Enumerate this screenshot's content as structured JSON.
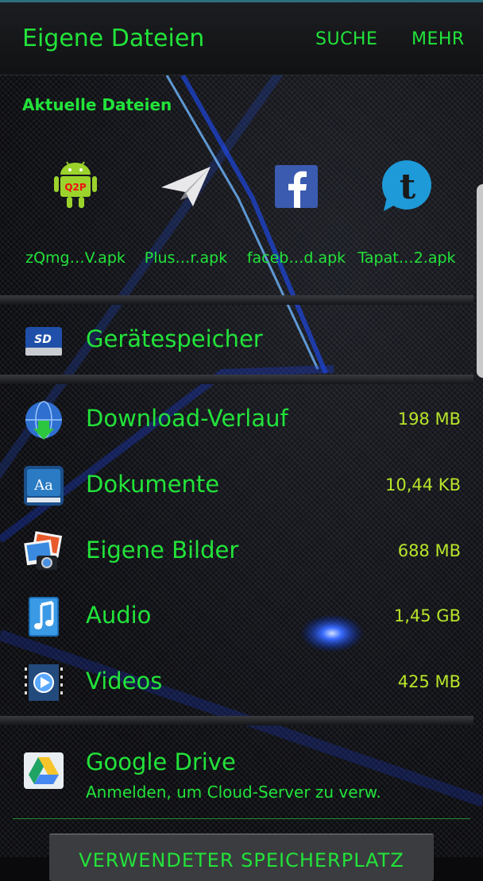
{
  "appbar": {
    "title": "Eigene Dateien",
    "search_label": "SUCHE",
    "more_label": "MEHR"
  },
  "recent": {
    "heading": "Aktuelle Dateien",
    "items": [
      {
        "name": "zQmg…V.apk",
        "icon": "q2p-android-icon"
      },
      {
        "name": "Plus…r.apk",
        "icon": "paper-plane-icon"
      },
      {
        "name": "faceb…d.apk",
        "icon": "facebook-icon"
      },
      {
        "name": "Tapat…2.apk",
        "icon": "tapatalk-icon"
      }
    ]
  },
  "storage": {
    "device_label": "Gerätespeicher"
  },
  "categories": [
    {
      "label": "Download-Verlauf",
      "size": "198 MB",
      "icon": "globe-download-icon"
    },
    {
      "label": "Dokumente",
      "size": "10,44 KB",
      "icon": "document-aa-icon"
    },
    {
      "label": "Eigene Bilder",
      "size": "688 MB",
      "icon": "photos-icon"
    },
    {
      "label": "Audio",
      "size": "1,45 GB",
      "icon": "music-note-icon"
    },
    {
      "label": "Videos",
      "size": "425 MB",
      "icon": "video-play-icon"
    }
  ],
  "cloud": {
    "title": "Google Drive",
    "subtitle": "Anmelden, um Cloud-Server zu verw."
  },
  "footer": {
    "button_label": "VERWENDETER SPEICHERPLATZ"
  },
  "colors": {
    "accent": "#22e33a",
    "size_text": "#b8e52a",
    "background": "#0a0a0c"
  }
}
